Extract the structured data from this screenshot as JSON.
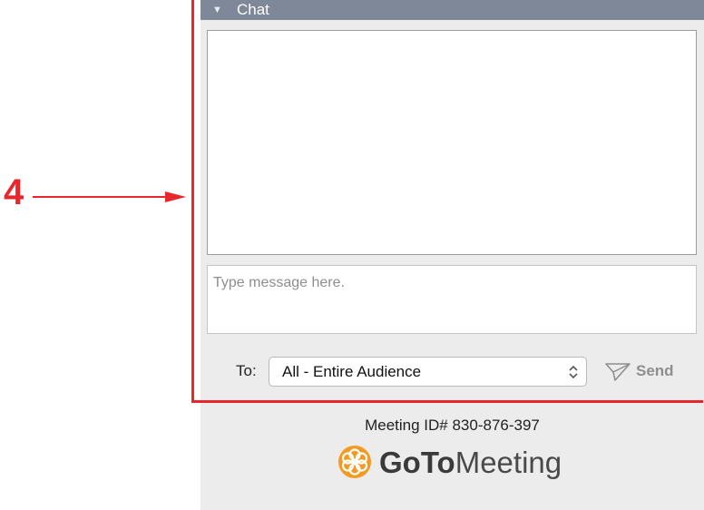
{
  "callout": {
    "number": "4"
  },
  "chat": {
    "header_title": "Chat",
    "message_placeholder": "Type message here.",
    "to_label": "To:",
    "recipient_selected": "All - Entire Audience",
    "send_label": "Send"
  },
  "footer": {
    "meeting_id": "Meeting ID# 830-876-397",
    "brand_bold": "GoTo",
    "brand_regular": "Meeting"
  },
  "colors": {
    "header_bg": "#7f8899",
    "callout_red": "#e8262b",
    "brand_orange": "#f39a21"
  }
}
